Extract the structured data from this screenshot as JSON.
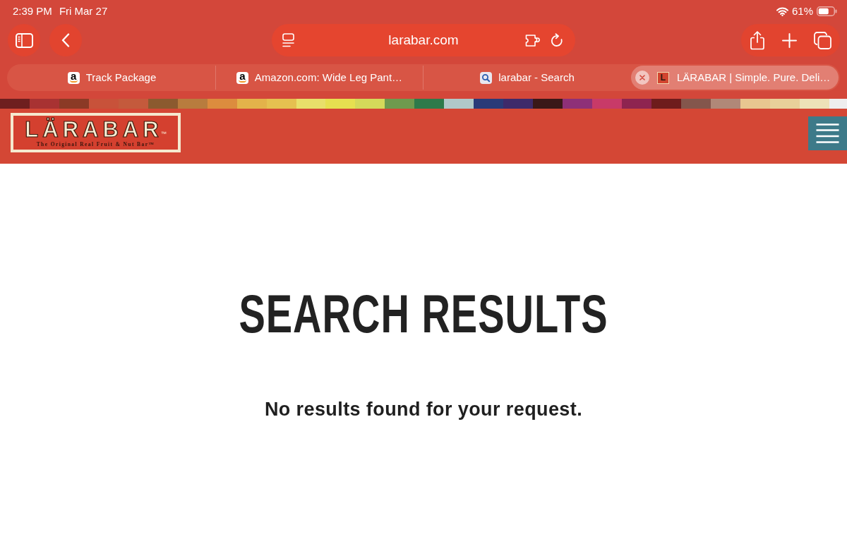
{
  "status_bar": {
    "time": "2:39 PM",
    "date": "Fri Mar 27",
    "battery": "61%"
  },
  "toolbar": {
    "address": "larabar.com"
  },
  "tabs": [
    {
      "title": "Track Package",
      "favicon": {
        "kind": "smile_letter",
        "text": "a"
      },
      "selected": false
    },
    {
      "title": "Amazon.com: Wide Leg Pant…",
      "favicon": {
        "kind": "smile_letter",
        "text": "a"
      },
      "selected": false
    },
    {
      "title": "larabar - Search",
      "favicon": {
        "kind": "search"
      },
      "selected": false
    },
    {
      "title": "LÄRABAR | Simple. Pure. Deli…",
      "favicon": {
        "kind": "boxed_letter",
        "text": "L"
      },
      "selected": true
    }
  ],
  "site_header": {
    "logo": "LÄRABAR",
    "trademark": "™",
    "tagline": "The Original Real Fruit & Nut Bar™"
  },
  "main": {
    "heading": "SEARCH RESULTS",
    "message": "No results found for your request."
  }
}
